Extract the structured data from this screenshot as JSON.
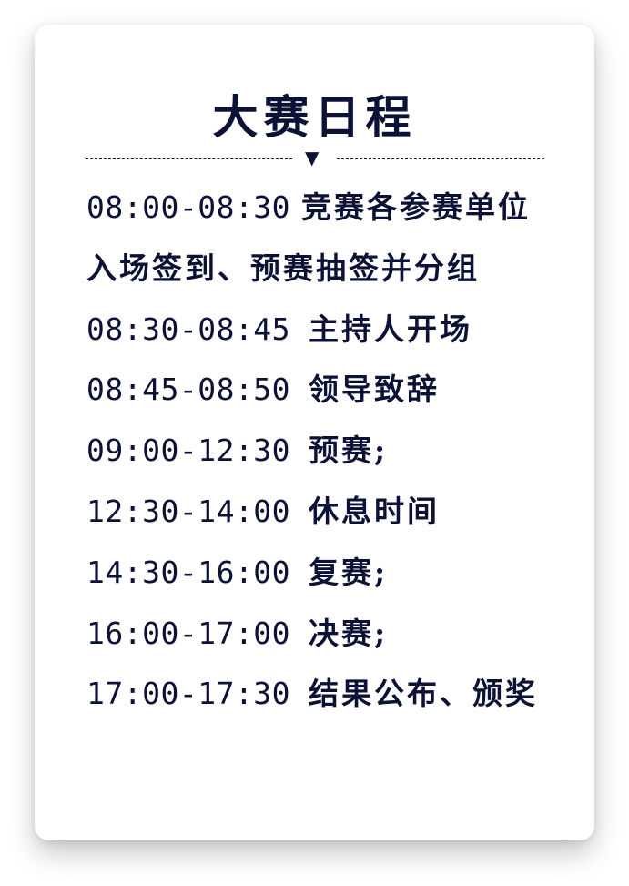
{
  "title": "大赛日程",
  "colors": {
    "text": "#0c1236",
    "card_background": "#ffffff"
  },
  "divider_icon": "down-triangle-icon",
  "schedule": [
    {
      "time": "08:00-08:30",
      "event": "竞赛各参赛单位"
    },
    {
      "time": "",
      "event": "入场签到、预赛抽签并分组"
    },
    {
      "time": "08:30-08:45",
      "event": "主持人开场"
    },
    {
      "time": "08:45-08:50",
      "event": "领导致辞"
    },
    {
      "time": "09:00-12:30",
      "event": "预赛;"
    },
    {
      "time": "12:30-14:00",
      "event": "休息时间"
    },
    {
      "time": "14:30-16:00",
      "event": "复赛;"
    },
    {
      "time": "16:00-17:00",
      "event": "决赛;"
    },
    {
      "time": "17:00-17:30",
      "event": "结果公布、颁奖"
    }
  ]
}
